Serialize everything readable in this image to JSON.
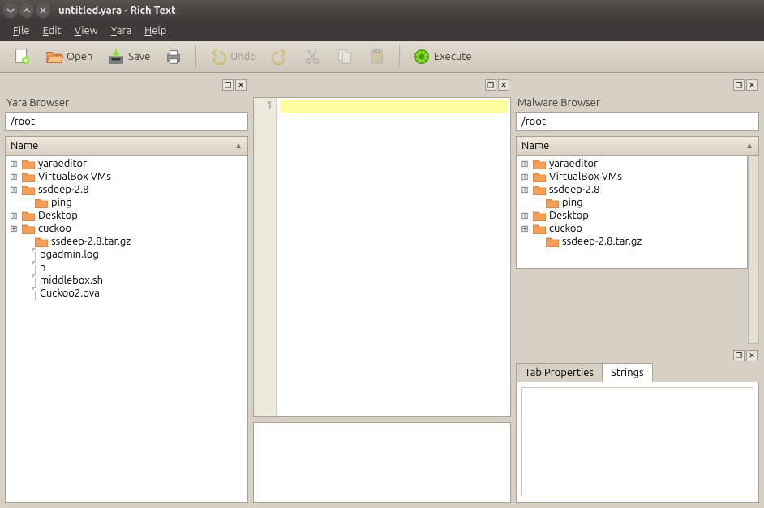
{
  "window": {
    "title": "untitled.yara - Rich Text"
  },
  "menu": {
    "file": "File",
    "edit": "Edit",
    "view": "View",
    "yara": "Yara",
    "help": "Help"
  },
  "toolbar": {
    "open": "Open",
    "save": "Save",
    "undo": "Undo",
    "execute": "Execute"
  },
  "yara_browser": {
    "title": "Yara Browser",
    "path": "/root",
    "column": "Name",
    "items": [
      {
        "type": "folder",
        "name": "yaraeditor",
        "expandable": true
      },
      {
        "type": "folder",
        "name": "VirtualBox VMs",
        "expandable": true
      },
      {
        "type": "folder",
        "name": "ssdeep-2.8",
        "expandable": true
      },
      {
        "type": "folder",
        "name": "ping",
        "expandable": false,
        "indent": 1
      },
      {
        "type": "folder",
        "name": "Desktop",
        "expandable": true
      },
      {
        "type": "folder",
        "name": "cuckoo",
        "expandable": true
      },
      {
        "type": "folder",
        "name": "ssdeep-2.8.tar.gz",
        "expandable": false,
        "indent": 1
      },
      {
        "type": "file",
        "name": "pgadmin.log",
        "indent": 1
      },
      {
        "type": "file",
        "name": "n",
        "indent": 1
      },
      {
        "type": "file",
        "name": "middlebox.sh",
        "indent": 1
      },
      {
        "type": "file",
        "name": "Cuckoo2.ova",
        "indent": 1
      }
    ]
  },
  "editor": {
    "line_number": "1"
  },
  "malware_browser": {
    "title": "Malware Browser",
    "path": "/root",
    "column": "Name",
    "items": [
      {
        "type": "folder",
        "name": "yaraeditor",
        "expandable": true
      },
      {
        "type": "folder",
        "name": "VirtualBox VMs",
        "expandable": true
      },
      {
        "type": "folder",
        "name": "ssdeep-2.8",
        "expandable": true
      },
      {
        "type": "folder",
        "name": "ping",
        "expandable": false,
        "indent": 1
      },
      {
        "type": "folder",
        "name": "Desktop",
        "expandable": true
      },
      {
        "type": "folder",
        "name": "cuckoo",
        "expandable": true
      },
      {
        "type": "folder",
        "name": "ssdeep-2.8.tar.gz",
        "expandable": false,
        "indent": 1
      }
    ]
  },
  "tabs": {
    "properties": "Tab Properties",
    "strings": "Strings"
  },
  "colors": {
    "accent": "#f07746",
    "highlight": "#ffffa0"
  }
}
